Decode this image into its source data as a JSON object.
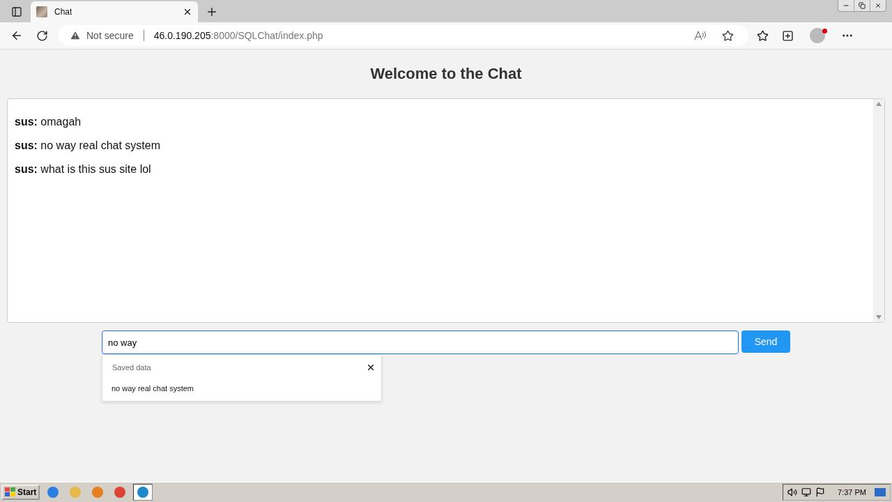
{
  "browser": {
    "tabs": [
      {
        "title": "Chat",
        "selected": true
      }
    ],
    "security": "Not secure",
    "address": {
      "host": "46.0.190.205",
      "path": ":8000/SQLChat/index.php"
    }
  },
  "page": {
    "heading": "Welcome to the Chat",
    "messages": [
      {
        "user": "sus:",
        "text": "omagah"
      },
      {
        "user": "sus:",
        "text": "no way real chat system"
      },
      {
        "user": "sus:",
        "text": "what is this sus site lol"
      }
    ],
    "input": {
      "value": "no way "
    },
    "send": "Send",
    "autofill": {
      "title": "Saved data",
      "items": [
        "no way real chat system"
      ]
    }
  },
  "taskbar": {
    "start": "Start",
    "clock": "7:37 PM"
  }
}
